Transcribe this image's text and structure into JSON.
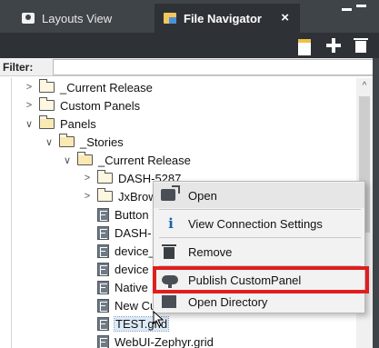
{
  "tabs": {
    "layouts_view": "Layouts View",
    "file_navigator": "File Navigator",
    "close_glyph": "×"
  },
  "filter": {
    "label": "Filter:",
    "value": "",
    "placeholder": ""
  },
  "tree": {
    "items": [
      {
        "label": "_Current Release",
        "type": "folder",
        "expanded": false
      },
      {
        "label": "Custom Panels",
        "type": "folder",
        "expanded": false
      },
      {
        "label": "Panels",
        "type": "folder",
        "expanded": true
      },
      {
        "label": "_Stories",
        "type": "folder",
        "expanded": true
      },
      {
        "label": "_Current Release",
        "type": "folder",
        "expanded": true
      },
      {
        "label": "DASH-5287",
        "type": "folder",
        "expanded": false
      },
      {
        "label": "JxBrow",
        "type": "folder",
        "expanded": false
      },
      {
        "label": "Button",
        "type": "file"
      },
      {
        "label": "DASH-",
        "type": "file"
      },
      {
        "label": "device_",
        "type": "file"
      },
      {
        "label": "device",
        "type": "file"
      },
      {
        "label": "Native",
        "type": "file"
      },
      {
        "label": "New Cu",
        "type": "file"
      },
      {
        "label": "TEST.grid",
        "type": "file",
        "selected": true
      },
      {
        "label": "WebUI-Zephyr.grid",
        "type": "file"
      }
    ]
  },
  "context_menu": {
    "open": "Open",
    "view_connection_settings": "View Connection Settings",
    "remove": "Remove",
    "publish_custom_panel": "Publish CustomPanel",
    "open_directory": "Open Directory"
  },
  "colors": {
    "tab_bar": "#3f4449",
    "toolbar": "#2e3236",
    "highlight": "#e01e1e",
    "folder": "#fdf6e0"
  },
  "icons": {
    "tab_layouts": "camera-icon",
    "tab_file_navigator": "file-navigator-icon",
    "toolbar": [
      "new-note-icon",
      "plus-icon",
      "trash-icon"
    ],
    "menu": [
      "open-icon",
      "info-icon",
      "trash-icon",
      "cloud-upload-icon",
      "directory-icon"
    ]
  }
}
